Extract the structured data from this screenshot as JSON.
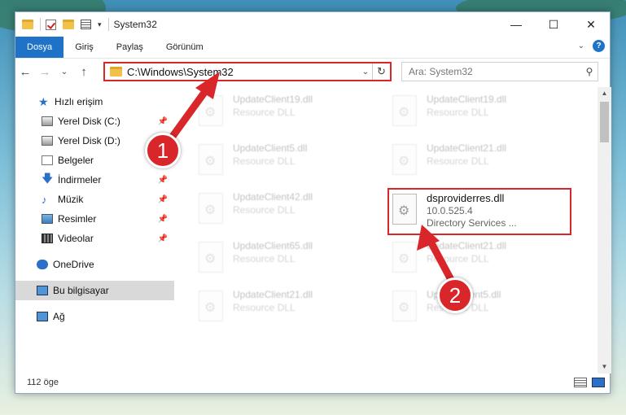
{
  "window": {
    "title": "System32"
  },
  "ribbon": {
    "tabs": [
      "Dosya",
      "Giriş",
      "Paylaş",
      "Görünüm"
    ],
    "active": 0
  },
  "address": {
    "path": "C:\\Windows\\System32"
  },
  "search": {
    "placeholder": "Ara: System32"
  },
  "sidebar": {
    "items": [
      {
        "label": "Hızlı erişim",
        "icon": "star-icon",
        "pinned": false
      },
      {
        "label": "Yerel Disk (C:)",
        "icon": "drive-icon",
        "pinned": true
      },
      {
        "label": "Yerel Disk (D:)",
        "icon": "drive-icon",
        "pinned": false
      },
      {
        "label": "Belgeler",
        "icon": "documents-icon",
        "pinned": true
      },
      {
        "label": "İndirmeler",
        "icon": "download-icon",
        "pinned": true
      },
      {
        "label": "Müzik",
        "icon": "music-icon",
        "pinned": true
      },
      {
        "label": "Resimler",
        "icon": "pictures-icon",
        "pinned": true
      },
      {
        "label": "Videolar",
        "icon": "videos-icon",
        "pinned": true
      },
      {
        "label": "OneDrive",
        "icon": "onedrive-icon",
        "pinned": false
      },
      {
        "label": "Bu bilgisayar",
        "icon": "this-pc-icon",
        "pinned": false
      },
      {
        "label": "Ağ",
        "icon": "network-icon",
        "pinned": false
      }
    ]
  },
  "files": [
    {
      "name": "UpdateClient19.dll",
      "desc": "Resource DLL"
    },
    {
      "name": "UpdateClient19.dll",
      "desc": "Resource DLL"
    },
    {
      "name": "UpdateClient5.dll",
      "desc": "Resource DLL"
    },
    {
      "name": "UpdateClient21.dll",
      "desc": "Resource DLL"
    },
    {
      "name": "UpdateClient42.dll",
      "desc": "Resource DLL"
    },
    {
      "name": "UpdateClient65.dll",
      "desc": "Resource DLL"
    },
    {
      "name": "UpdateClient21.dll",
      "desc": "Resource DLL"
    },
    {
      "name": "UpdateClient21.dll",
      "desc": "Resource DLL"
    },
    {
      "name": "UpdateClient5.dll",
      "desc": "Resource DLL"
    }
  ],
  "highlighted_file": {
    "name": "dsproviderres.dll",
    "version": "10.0.525.4",
    "desc": "Directory Services ..."
  },
  "status": {
    "count": "112 öge"
  },
  "annotations": {
    "badge1": "1",
    "badge2": "2",
    "color": "#d9262a"
  }
}
